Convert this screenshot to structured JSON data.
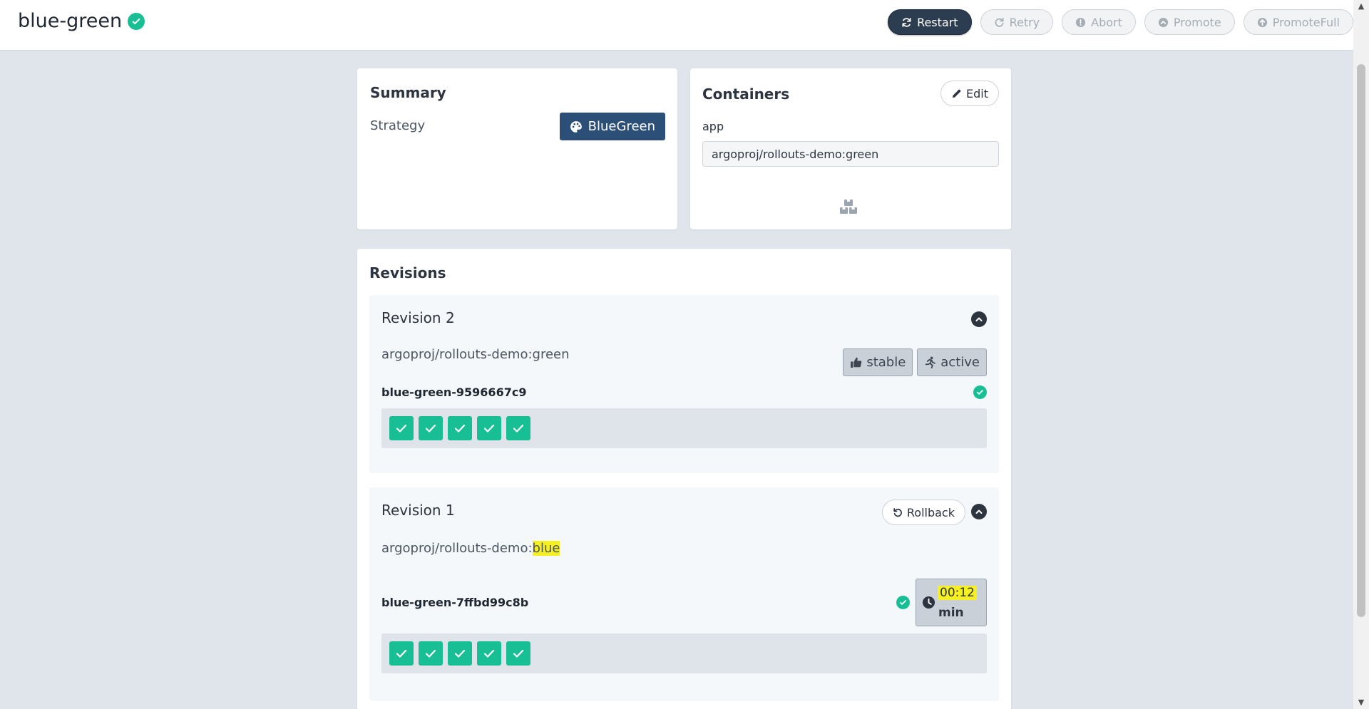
{
  "header": {
    "title": "blue-green",
    "actions": {
      "restart": "Restart",
      "retry": "Retry",
      "abort": "Abort",
      "promote": "Promote",
      "promote_full": "PromoteFull"
    }
  },
  "summary": {
    "title": "Summary",
    "strategy_label": "Strategy",
    "strategy_value": "BlueGreen"
  },
  "containers": {
    "title": "Containers",
    "edit_label": "Edit",
    "items": [
      {
        "name": "app",
        "image": "argoproj/rollouts-demo:green"
      }
    ]
  },
  "revisions": {
    "title": "Revisions",
    "items": [
      {
        "title": "Revision 2",
        "image_prefix": "argoproj/rollouts-demo:",
        "image_tag": "green",
        "tags": [
          "stable",
          "active"
        ],
        "replicaset": "blue-green-9596667c9",
        "pods": 5
      },
      {
        "title": "Revision 1",
        "rollback_label": "Rollback",
        "image_prefix": "argoproj/rollouts-demo:",
        "image_tag": "blue",
        "replicaset": "blue-green-7ffbd99c8b",
        "timer_value": "00:12",
        "timer_unit": "min",
        "pods": 5
      }
    ]
  },
  "colors": {
    "success": "#18be94",
    "primary": "#2c3d51",
    "highlight": "#f7f021"
  }
}
